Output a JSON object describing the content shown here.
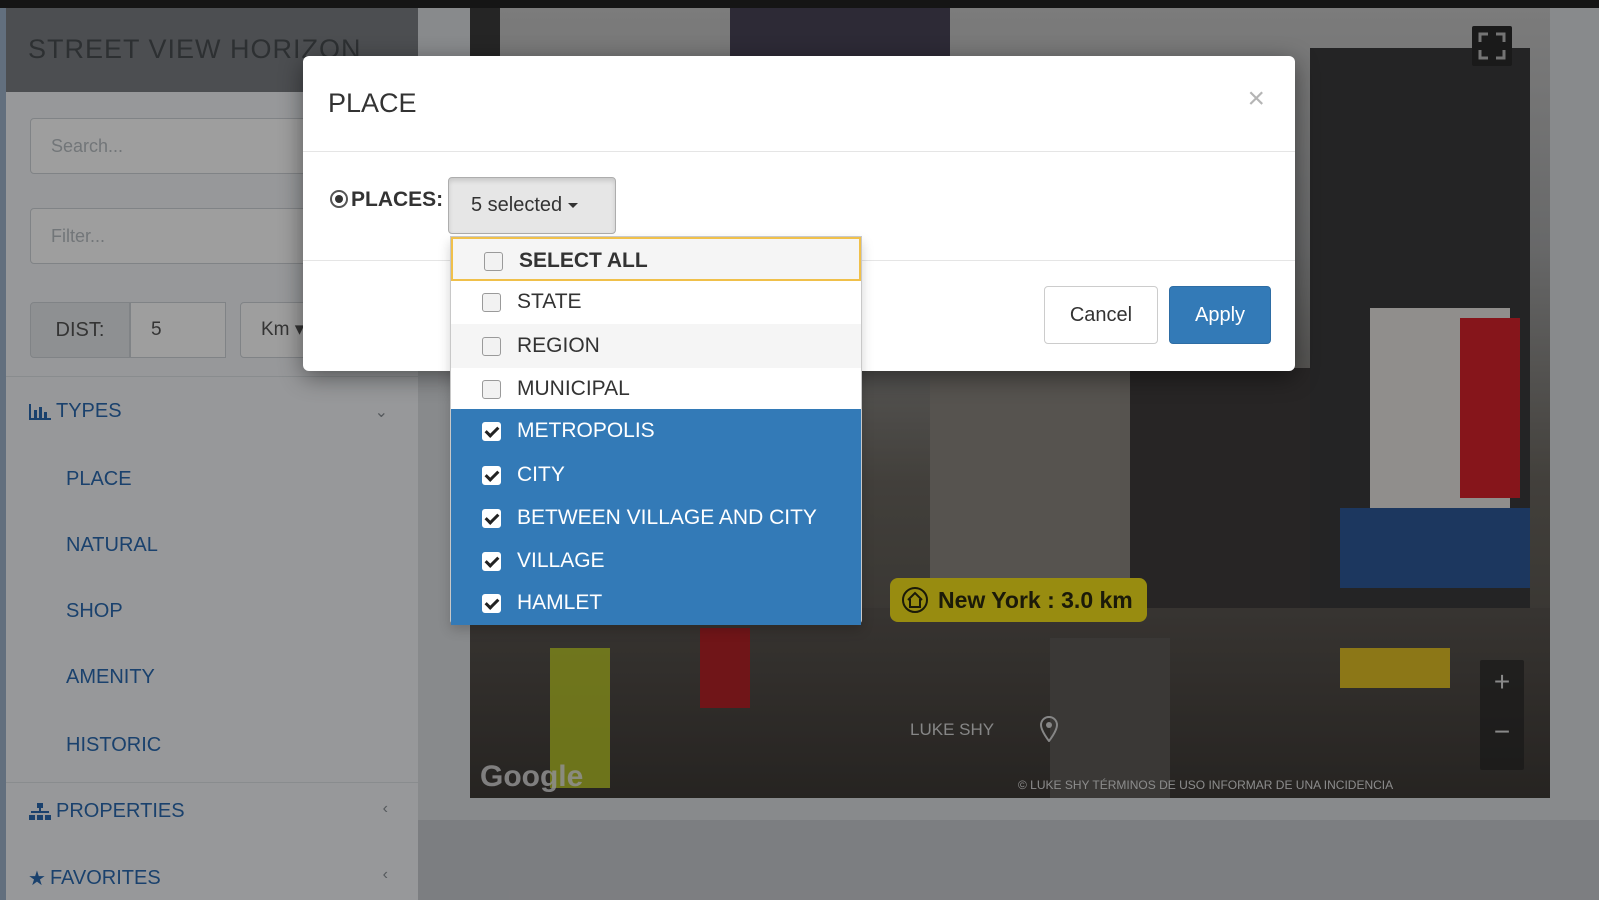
{
  "app": {
    "title": "STREET VIEW HORIZON",
    "search_placeholder": "Search...",
    "filter_placeholder": "Filter...",
    "dist_label": "DIST:",
    "dist_value": "5",
    "dist_unit": "Km",
    "sections": {
      "types": "TYPES",
      "properties": "PROPERTIES",
      "favorites": "FAVORITES"
    },
    "type_items": [
      "PLACE",
      "NATURAL",
      "SHOP",
      "AMENITY",
      "HISTORIC"
    ]
  },
  "panorama": {
    "distance_label": "New York : 3.0 km",
    "author": "LUKE SHY",
    "google_logo": "Google",
    "attribution": "© LUKE SHY    TÉRMINOS DE USO    INFORMAR DE UNA INCIDENCIA",
    "zoom_in": "+",
    "zoom_out": "−"
  },
  "modal": {
    "title": "PLACE",
    "close": "×",
    "places_label": "PLACES:",
    "dropdown_value": "5 selected",
    "cancel_label": "Cancel",
    "apply_label": "Apply",
    "options": [
      {
        "label": "SELECT ALL",
        "checked": false
      },
      {
        "label": "STATE",
        "checked": false
      },
      {
        "label": "REGION",
        "checked": false
      },
      {
        "label": "MUNICIPAL",
        "checked": false
      },
      {
        "label": "METROPOLIS",
        "checked": true
      },
      {
        "label": "CITY",
        "checked": true
      },
      {
        "label": "BETWEEN VILLAGE AND CITY",
        "checked": true
      },
      {
        "label": "VILLAGE",
        "checked": true
      },
      {
        "label": "HAMLET",
        "checked": true
      }
    ]
  },
  "colors": {
    "accent": "#337ab7",
    "link": "#2a6ab0",
    "tag_yellow": "#f5e21a"
  }
}
